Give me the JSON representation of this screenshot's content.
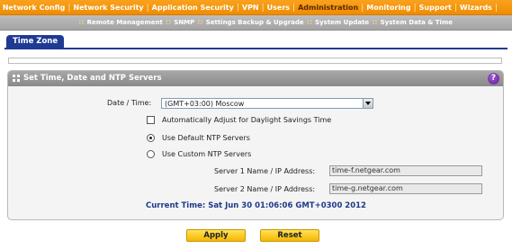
{
  "topnav": {
    "items": [
      {
        "label": "Network Config",
        "active": false
      },
      {
        "label": "Network Security",
        "active": false
      },
      {
        "label": "Application Security",
        "active": false
      },
      {
        "label": "VPN",
        "active": false
      },
      {
        "label": "Users",
        "active": false
      },
      {
        "label": "Administration",
        "active": true
      },
      {
        "label": "Monitoring",
        "active": false
      },
      {
        "label": "Support",
        "active": false
      },
      {
        "label": "Wizards",
        "active": false
      }
    ]
  },
  "subnav": {
    "items": [
      "Remote Management",
      "SNMP",
      "Settings Backup & Upgrade",
      "System Update",
      "System Data & Time"
    ]
  },
  "tab": {
    "label": "Time Zone"
  },
  "panel": {
    "title": "Set Time, Date and NTP Servers",
    "help_icon": "?",
    "date_time_label": "Date / Time:",
    "date_time_value": "(GMT+03:00) Moscow",
    "dst_label": "Automatically Adjust for Daylight Savings Time",
    "default_ntp_label": "Use Default NTP Servers",
    "custom_ntp_label": "Use Custom NTP Servers",
    "server1_label": "Server 1 Name / IP Address:",
    "server1_value": "time-f.netgear.com",
    "server2_label": "Server 2 Name / IP Address:",
    "server2_value": "time-g.netgear.com",
    "current_time": "Current Time: Sat Jun 30 01:06:06 GMT+0300 2012"
  },
  "buttons": {
    "apply": "Apply",
    "reset": "Reset"
  },
  "colors": {
    "nav_orange": "#f59a10",
    "tab_blue": "#1f3a93",
    "button_yellow": "#ffd21f"
  }
}
